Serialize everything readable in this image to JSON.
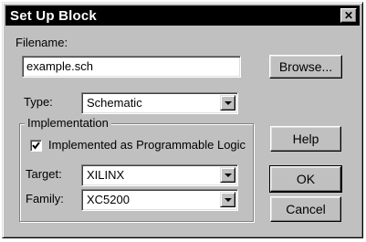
{
  "window": {
    "title": "Set Up Block"
  },
  "filename": {
    "label": "Filename:",
    "value": "example.sch"
  },
  "browse_button": "Browse...",
  "type": {
    "label": "Type:",
    "selected": "Schematic"
  },
  "implementation": {
    "legend": "Implementation",
    "checkbox_label": "Implemented as Programmable Logic",
    "checked": true,
    "target": {
      "label": "Target:",
      "selected": "XILINX"
    },
    "family": {
      "label": "Family:",
      "selected": "XC5200"
    }
  },
  "buttons": {
    "help": "Help",
    "ok": "OK",
    "cancel": "Cancel"
  }
}
